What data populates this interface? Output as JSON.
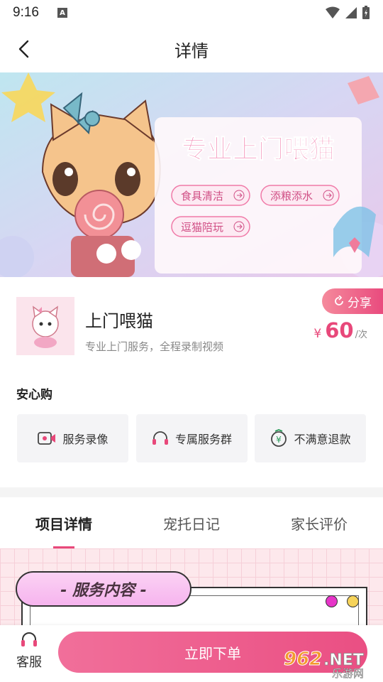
{
  "status_bar": {
    "time": "9:16",
    "notif_letter": "A"
  },
  "nav": {
    "title": "详情"
  },
  "banner": {
    "title": "专业上门喂猫",
    "tags": [
      "食具清洁",
      "添粮添水",
      "逗猫陪玩"
    ]
  },
  "product": {
    "name": "上门喂猫",
    "desc": "专业上门服务，全程录制视频",
    "share_label": "分享",
    "price_symbol": "¥",
    "price": "60",
    "price_unit": "/次"
  },
  "assurance": {
    "title": "安心购",
    "items": [
      {
        "icon": "video-record-icon",
        "label": "服务录像"
      },
      {
        "icon": "headset-icon",
        "label": "专属服务群"
      },
      {
        "icon": "refund-icon",
        "label": "不满意退款"
      }
    ]
  },
  "tabs": [
    {
      "label": "项目详情",
      "active": true
    },
    {
      "label": "宠托日记",
      "active": false
    },
    {
      "label": "家长评价",
      "active": false
    }
  ],
  "content": {
    "section_title": "- 服务内容 -"
  },
  "bottom": {
    "service_label": "客服",
    "order_label": "立即下单"
  },
  "watermark": {
    "brand": "962",
    "suffix": ".NET",
    "site": "乐游网"
  },
  "colors": {
    "accent": "#e8487a",
    "button": "#ea4f83"
  }
}
